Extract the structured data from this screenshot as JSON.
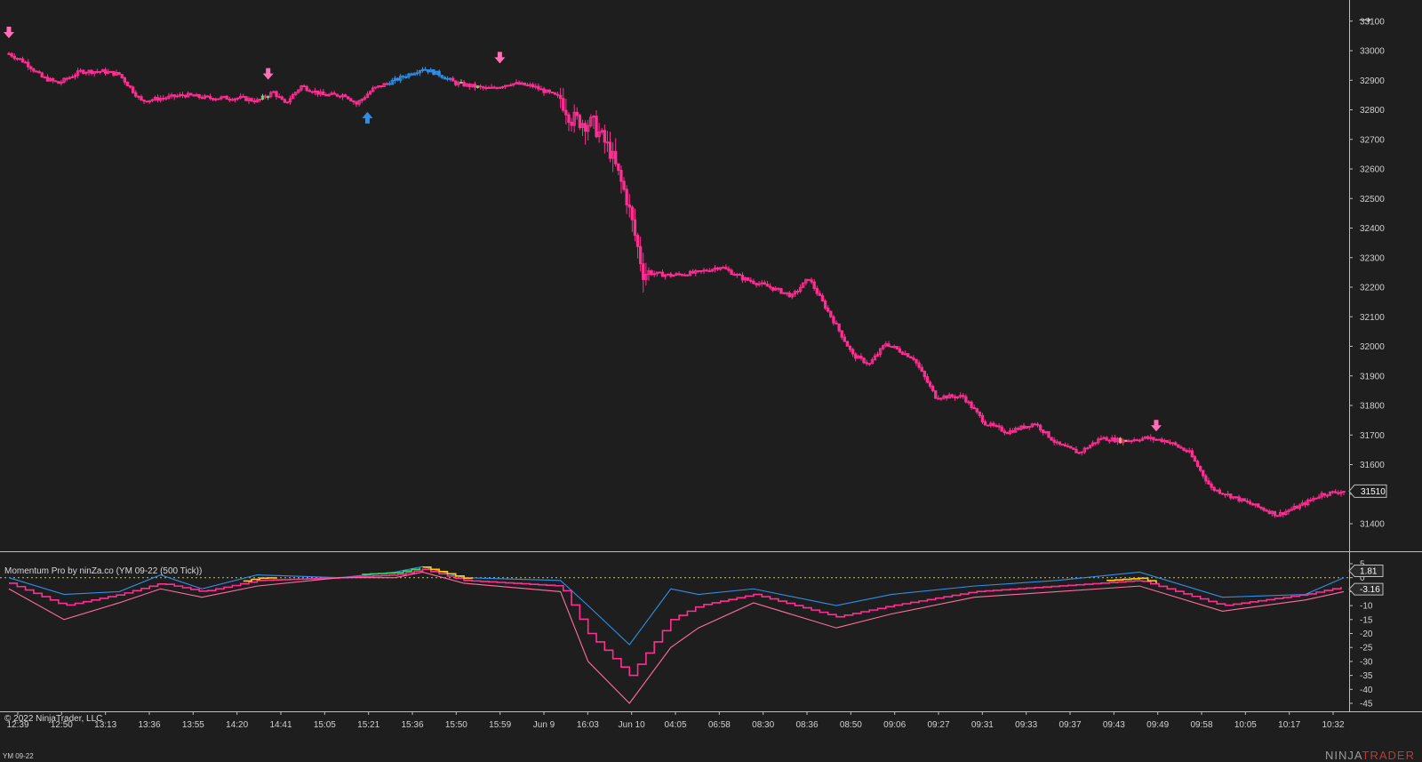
{
  "colors": {
    "background": "#1e1e1e",
    "bear_candle": "#ff2e93",
    "bull_candle_outline": "#ff2e93",
    "trend_up": "#2f8fe8",
    "neutral_green": "#7cd67c",
    "neutral_orange": "#ff9966",
    "signal_arrow_down": "#ff6fb5",
    "signal_arrow_up": "#2f8fe8",
    "momentum_blue": "#2f8fe8",
    "momentum_main": "#ff2e93",
    "momentum_slow": "#ff6f9f",
    "zero_line": "#c8b400",
    "hot_yellow": "#ffcc00",
    "hot_green": "#33dd55"
  },
  "header": {
    "indicator_title": "Momentum Pro by ninZa.co (YM 09-22 (500 Tick))",
    "copyright": "© 2022 NinjaTrader, LLC",
    "instrument": "YM 09-22",
    "brand_left": "NINJA",
    "brand_right": "TRADER"
  },
  "chart_data": [
    {
      "type": "candlestick",
      "title": "",
      "ylim": [
        31330,
        33140
      ],
      "y_ticks": [
        33100,
        33000,
        32900,
        32800,
        32700,
        32600,
        32500,
        32400,
        32300,
        32200,
        32100,
        32000,
        31900,
        31800,
        31700,
        31600,
        31500,
        31400
      ],
      "last_price": "31510",
      "x_tick_labels": [
        "12:39",
        "12:50",
        "13:13",
        "13:36",
        "13:55",
        "14:20",
        "14:41",
        "15:05",
        "15:21",
        "15:36",
        "15:50",
        "15:59",
        "Jun 9",
        "16:03",
        "Jun 10",
        "04:05",
        "06:58",
        "08:30",
        "08:36",
        "08:50",
        "09:06",
        "09:27",
        "09:31",
        "09:33",
        "09:37",
        "09:43",
        "09:49",
        "09:58",
        "10:05",
        "10:17",
        "10:32"
      ],
      "close_path": [
        [
          0,
          32990
        ],
        [
          6,
          32960
        ],
        [
          12,
          32910
        ],
        [
          18,
          32890
        ],
        [
          26,
          32930
        ],
        [
          34,
          32930
        ],
        [
          40,
          32920
        ],
        [
          48,
          32830
        ],
        [
          56,
          32840
        ],
        [
          64,
          32850
        ],
        [
          72,
          32840
        ],
        [
          78,
          32840
        ],
        [
          84,
          32840
        ],
        [
          90,
          32830
        ],
        [
          96,
          32860
        ],
        [
          100,
          32820
        ],
        [
          106,
          32880
        ],
        [
          114,
          32850
        ],
        [
          122,
          32850
        ],
        [
          126,
          32820
        ],
        [
          132,
          32870
        ],
        [
          140,
          32900
        ],
        [
          150,
          32940
        ],
        [
          156,
          32920
        ],
        [
          162,
          32890
        ],
        [
          168,
          32880
        ],
        [
          174,
          32870
        ],
        [
          182,
          32890
        ],
        [
          190,
          32880
        ],
        [
          200,
          32840
        ],
        [
          204,
          32770
        ],
        [
          212,
          32750
        ],
        [
          218,
          32660
        ],
        [
          224,
          32500
        ],
        [
          230,
          32250
        ],
        [
          240,
          32240
        ],
        [
          250,
          32250
        ],
        [
          258,
          32270
        ],
        [
          266,
          32230
        ],
        [
          276,
          32200
        ],
        [
          284,
          32170
        ],
        [
          290,
          32230
        ],
        [
          300,
          32070
        ],
        [
          306,
          31970
        ],
        [
          312,
          31940
        ],
        [
          318,
          32010
        ],
        [
          328,
          31960
        ],
        [
          336,
          31830
        ],
        [
          346,
          31830
        ],
        [
          354,
          31740
        ],
        [
          362,
          31710
        ],
        [
          372,
          31740
        ],
        [
          380,
          31670
        ],
        [
          388,
          31640
        ],
        [
          396,
          31690
        ],
        [
          404,
          31680
        ],
        [
          412,
          31690
        ],
        [
          420,
          31680
        ],
        [
          428,
          31640
        ],
        [
          436,
          31520
        ],
        [
          444,
          31490
        ],
        [
          452,
          31460
        ],
        [
          460,
          31430
        ],
        [
          468,
          31460
        ],
        [
          476,
          31500
        ],
        [
          484,
          31510
        ]
      ],
      "trend_up_range": [
        138,
        160
      ],
      "neutral_candles": [
        92,
        94,
        164,
        170,
        403,
        405
      ],
      "signal_arrows": [
        {
          "index": 0,
          "dir": "down",
          "price": 33060
        },
        {
          "index": 94,
          "dir": "down",
          "price": 32920
        },
        {
          "index": 130,
          "dir": "up",
          "price": 32775
        },
        {
          "index": 178,
          "dir": "down",
          "price": 32975
        },
        {
          "index": 416,
          "dir": "down",
          "price": 31730
        }
      ],
      "bar_count": 485
    },
    {
      "type": "line",
      "title": "Momentum Pro by ninZa.co (YM 09-22 (500 Tick))",
      "ylim": [
        -47,
        6
      ],
      "y_ticks": [
        5,
        0,
        -5,
        -10,
        -15,
        -20,
        -25,
        -30,
        -35,
        -40,
        -45
      ],
      "value_labels": [
        "1.81",
        "-3.16"
      ],
      "zero_level": 0,
      "x_range": [
        0,
        484
      ],
      "series": [
        {
          "role": "fast",
          "color_key": "momentum_blue",
          "points": [
            [
              0,
              0
            ],
            [
              20,
              -6
            ],
            [
              40,
              -5
            ],
            [
              55,
              1
            ],
            [
              70,
              -4
            ],
            [
              90,
              1
            ],
            [
              120,
              0
            ],
            [
              140,
              2
            ],
            [
              150,
              4
            ],
            [
              165,
              0
            ],
            [
              200,
              -1
            ],
            [
              210,
              -10
            ],
            [
              225,
              -24
            ],
            [
              240,
              -4
            ],
            [
              250,
              -6
            ],
            [
              270,
              -4
            ],
            [
              300,
              -10
            ],
            [
              320,
              -6
            ],
            [
              350,
              -3
            ],
            [
              380,
              -1
            ],
            [
              410,
              2
            ],
            [
              440,
              -7
            ],
            [
              470,
              -6
            ],
            [
              484,
              0
            ]
          ]
        },
        {
          "role": "main",
          "color_key": "momentum_main",
          "points": [
            [
              0,
              -2
            ],
            [
              20,
              -10
            ],
            [
              40,
              -6
            ],
            [
              55,
              -2
            ],
            [
              70,
              -5
            ],
            [
              90,
              -1
            ],
            [
              120,
              0
            ],
            [
              140,
              1
            ],
            [
              150,
              3
            ],
            [
              165,
              -1
            ],
            [
              200,
              -3
            ],
            [
              210,
              -20
            ],
            [
              225,
              -35
            ],
            [
              240,
              -15
            ],
            [
              250,
              -10
            ],
            [
              270,
              -6
            ],
            [
              300,
              -14
            ],
            [
              320,
              -10
            ],
            [
              350,
              -5
            ],
            [
              380,
              -3
            ],
            [
              410,
              -1
            ],
            [
              440,
              -10
            ],
            [
              470,
              -6
            ],
            [
              484,
              -3.16
            ]
          ]
        },
        {
          "role": "slow",
          "color_key": "momentum_slow",
          "points": [
            [
              0,
              -4
            ],
            [
              20,
              -15
            ],
            [
              40,
              -9
            ],
            [
              55,
              -4
            ],
            [
              70,
              -7
            ],
            [
              90,
              -3
            ],
            [
              120,
              0
            ],
            [
              140,
              0
            ],
            [
              150,
              2
            ],
            [
              165,
              -2
            ],
            [
              200,
              -5
            ],
            [
              210,
              -30
            ],
            [
              225,
              -45
            ],
            [
              240,
              -25
            ],
            [
              250,
              -18
            ],
            [
              270,
              -9
            ],
            [
              300,
              -18
            ],
            [
              320,
              -13
            ],
            [
              350,
              -7
            ],
            [
              380,
              -5
            ],
            [
              410,
              -3
            ],
            [
              440,
              -12
            ],
            [
              470,
              -8
            ],
            [
              484,
              -5
            ]
          ]
        }
      ],
      "highlights": [
        {
          "from": 85,
          "to": 98,
          "color_key": "hot_yellow"
        },
        {
          "from": 128,
          "to": 150,
          "color_key": "hot_green"
        },
        {
          "from": 150,
          "to": 168,
          "color_key": "hot_yellow"
        },
        {
          "from": 398,
          "to": 418,
          "color_key": "hot_yellow"
        }
      ]
    }
  ]
}
